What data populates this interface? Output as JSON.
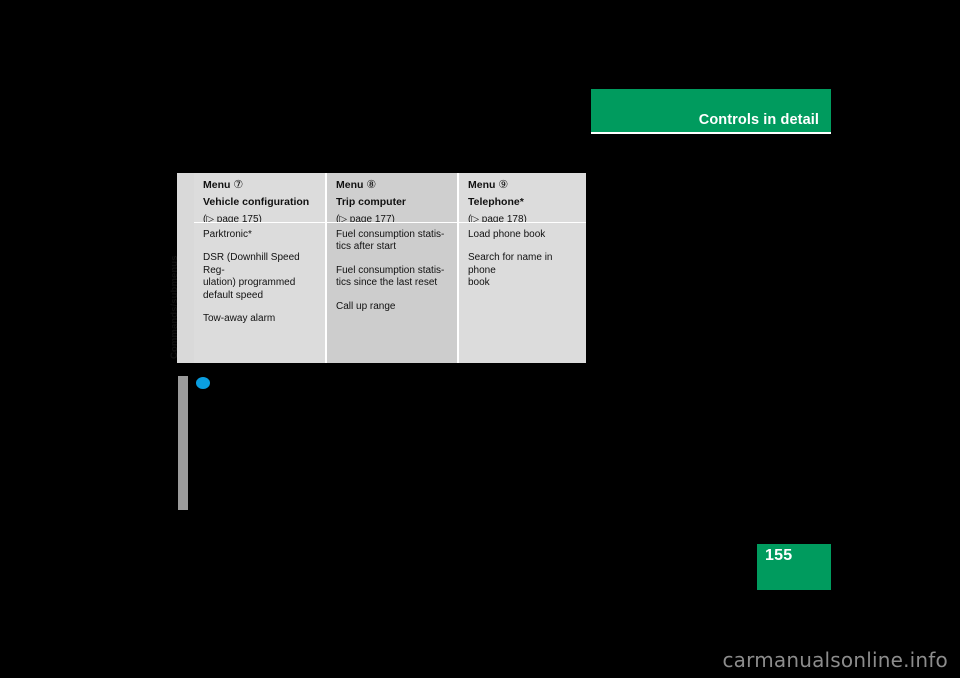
{
  "header": {
    "banner_title": "Controls in detail",
    "banner_color": "#009b5e"
  },
  "page_footer": {
    "page_number": "155",
    "block_color": "#009b5e"
  },
  "icons": {
    "blue_bullet": "blue-circle-icon",
    "edge_tab": "page-edge-tab-marker"
  },
  "table": {
    "side_label": "Commands/submenus",
    "columns": [
      {
        "menu_label": "Menu",
        "menu_number": "⑦",
        "menu_name": "Vehicle configuration",
        "page_ref": "(▷ page 175)",
        "entries": [
          "Parktronic*",
          "DSR (Downhill Speed Reg-\nulation) programmed\ndefault speed",
          "Tow-away alarm"
        ]
      },
      {
        "menu_label": "Menu",
        "menu_number": "⑧",
        "menu_name": "Trip computer",
        "page_ref": "(▷ page 177)",
        "entries": [
          "Fuel consumption statis-\ntics after start",
          "Fuel consumption statis-\ntics since the last reset",
          "Call up range"
        ]
      },
      {
        "menu_label": "Menu",
        "menu_number": "⑨",
        "menu_name": "Telephone*",
        "page_ref": "(▷ page 178)",
        "entries": [
          "Load phone book",
          "Search for name in phone\nbook"
        ]
      }
    ]
  },
  "watermark": {
    "text": "carmanualsonline.info"
  }
}
